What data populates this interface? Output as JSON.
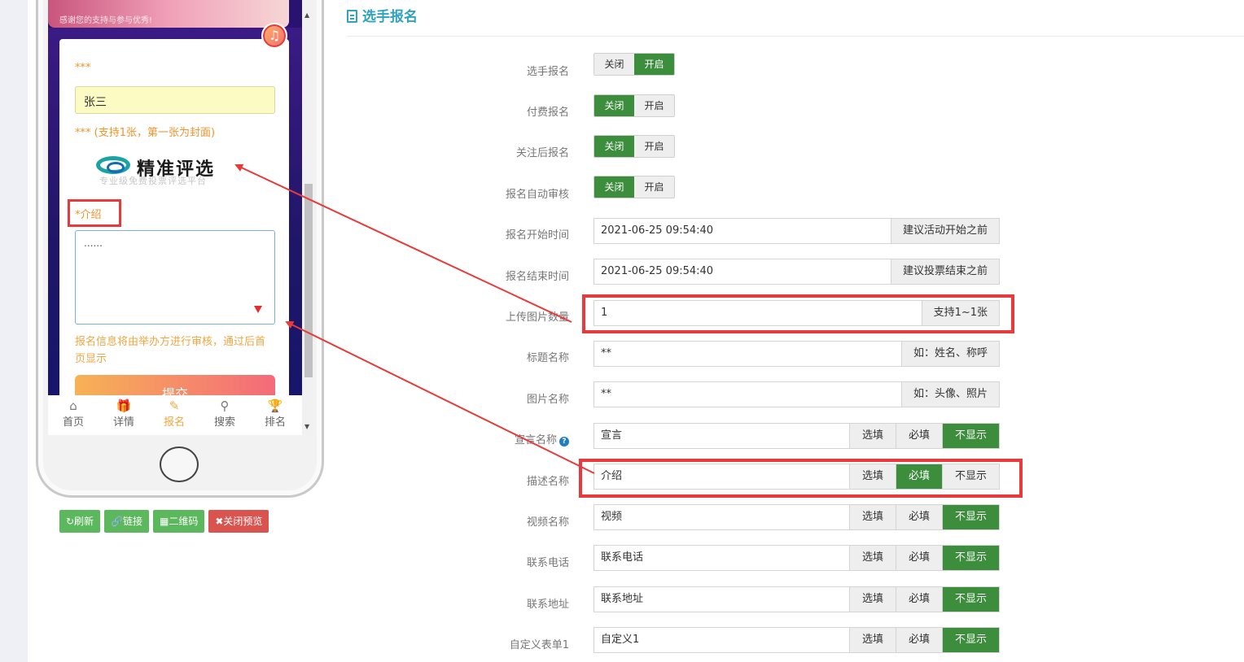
{
  "preview": {
    "topbar_text": "感谢您的支持与参与优秀!",
    "name_label": "***",
    "name_value": "张三",
    "image_label": "*** (支持1张，第一张为封面)",
    "logo_title": "精准评选",
    "logo_subtitle": "专业级免费投票评选平台",
    "intro_label": "*介绍",
    "intro_value": "......",
    "notice": "报名信息将由举办方进行审核，通过后首页显示",
    "submit": "提交",
    "tabs": [
      {
        "icon": "⌂",
        "label": "首页",
        "active": false
      },
      {
        "icon": "🎁",
        "label": "详情",
        "active": false
      },
      {
        "icon": "✎",
        "label": "报名",
        "active": true
      },
      {
        "icon": "⚲",
        "label": "搜索",
        "active": false
      },
      {
        "icon": "🏆",
        "label": "排名",
        "active": false
      }
    ],
    "buttons": {
      "refresh": "↻刷新",
      "link": "🔗链接",
      "qrcode": "▦二维码",
      "close": "✖关闭预览"
    }
  },
  "panel": {
    "title": "选手报名",
    "rows": {
      "signup": {
        "label": "选手报名",
        "off": "关闭",
        "on": "开启",
        "state": "on"
      },
      "paid": {
        "label": "付费报名",
        "off": "关闭",
        "on": "开启",
        "state": "off"
      },
      "follow": {
        "label": "关注后报名",
        "off": "关闭",
        "on": "开启",
        "state": "off"
      },
      "auto_review": {
        "label": "报名自动审核",
        "off": "关闭",
        "on": "开启",
        "state": "off"
      },
      "start_time": {
        "label": "报名开始时间",
        "value": "2021-06-25 09:54:40",
        "addon": "建议活动开始之前"
      },
      "end_time": {
        "label": "报名结束时间",
        "value": "2021-06-25 09:54:40",
        "addon": "建议投票结束之前"
      },
      "image_count": {
        "label": "上传图片数量",
        "value": "1",
        "addon": "支持1~1张"
      },
      "title_name": {
        "label": "标题名称",
        "value": "**",
        "addon": "如：姓名、称呼"
      },
      "image_name": {
        "label": "图片名称",
        "value": "**",
        "addon": "如：头像、照片"
      },
      "slogan": {
        "label": "宣言名称",
        "value": "宣言",
        "optional": "选填",
        "required": "必填",
        "hidden": "不显示",
        "state": "hidden"
      },
      "desc": {
        "label": "描述名称",
        "value": "介绍",
        "optional": "选填",
        "required": "必填",
        "hidden": "不显示",
        "state": "required"
      },
      "video": {
        "label": "视频名称",
        "value": "视频",
        "optional": "选填",
        "required": "必填",
        "hidden": "不显示",
        "state": "hidden"
      },
      "phone": {
        "label": "联系电话",
        "value": "联系电话",
        "optional": "选填",
        "required": "必填",
        "hidden": "不显示",
        "state": "hidden"
      },
      "address": {
        "label": "联系地址",
        "value": "联系地址",
        "optional": "选填",
        "required": "必填",
        "hidden": "不显示",
        "state": "hidden"
      },
      "custom1": {
        "label": "自定义表单1",
        "value": "自定义1",
        "optional": "选填",
        "required": "必填",
        "hidden": "不显示",
        "state": "hidden"
      }
    }
  },
  "colors": {
    "active_green": "#3c8d3c",
    "highlight_red": "#e83a3a",
    "title_blue": "#30a3c0",
    "accent_orange": "#f0a640"
  }
}
